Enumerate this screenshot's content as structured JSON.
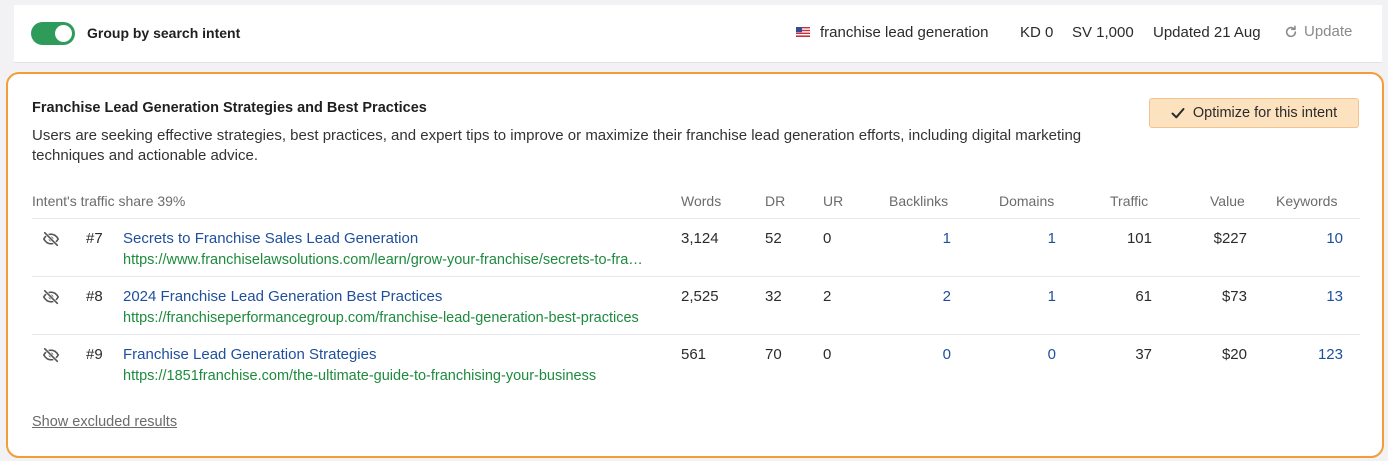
{
  "topbar": {
    "toggle_label": "Group by search intent",
    "toggle_on": true,
    "keyword": "franchise lead generation",
    "kd": "KD 0",
    "sv": "SV 1,000",
    "updated": "Updated 21 Aug",
    "update_label": "Update"
  },
  "intent": {
    "title": "Franchise Lead Generation Strategies and Best Practices",
    "description": "Users are seeking effective strategies, best practices, and expert tips to improve or maximize their franchise lead generation efforts, including digital marketing techniques and actionable advice.",
    "optimize_label": "Optimize for this intent"
  },
  "table": {
    "traffic_share": "Intent's traffic share 39%",
    "headers": {
      "words": "Words",
      "dr": "DR",
      "ur": "UR",
      "backlinks": "Backlinks",
      "domains": "Domains",
      "traffic": "Traffic",
      "value": "Value",
      "keywords": "Keywords"
    },
    "rows": [
      {
        "pos": "#7",
        "title": "Secrets to Franchise Sales Lead Generation",
        "url": "https://www.franchiselawsolutions.com/learn/grow-your-franchise/secrets-to-franchise-sales-lead-generation",
        "words": "3,124",
        "dr": "52",
        "ur": "0",
        "backlinks": "1",
        "domains": "1",
        "traffic": "101",
        "value": "$227",
        "keywords": "10"
      },
      {
        "pos": "#8",
        "title": "2024 Franchise Lead Generation Best Practices",
        "url": "https://franchiseperformancegroup.com/franchise-lead-generation-best-practices",
        "words": "2,525",
        "dr": "32",
        "ur": "2",
        "backlinks": "2",
        "domains": "1",
        "traffic": "61",
        "value": "$73",
        "keywords": "13"
      },
      {
        "pos": "#9",
        "title": "Franchise Lead Generation Strategies",
        "url": "https://1851franchise.com/the-ultimate-guide-to-franchising-your-business",
        "words": "561",
        "dr": "70",
        "ur": "0",
        "backlinks": "0",
        "domains": "0",
        "traffic": "37",
        "value": "$20",
        "keywords": "123"
      }
    ]
  },
  "show_excluded_label": "Show excluded results",
  "colors": {
    "accent_orange": "#f29d38",
    "toggle_green": "#2e9b5a",
    "link_blue": "#1f4f9c",
    "url_green": "#1e8a3e",
    "optimize_bg": "#fde2c0"
  }
}
